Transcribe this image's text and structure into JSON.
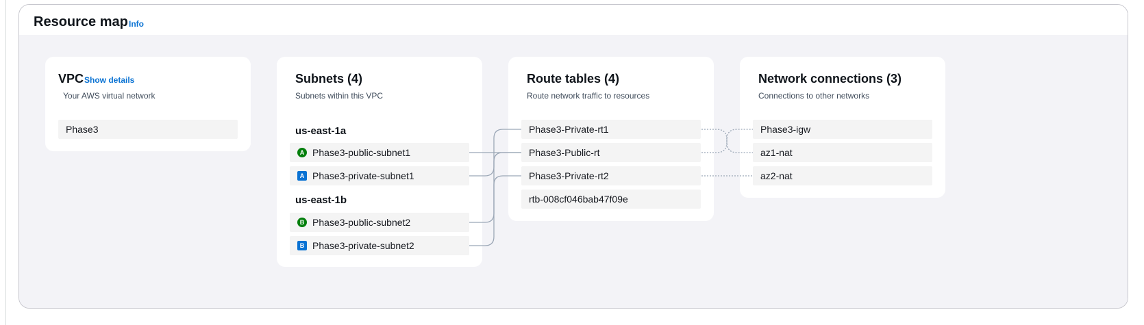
{
  "header": {
    "title": "Resource map",
    "info_label": "Info"
  },
  "vpc": {
    "title": "VPC",
    "show_details_label": "Show details",
    "description": "Your AWS virtual network",
    "name": "Phase3"
  },
  "subnets": {
    "title": "Subnets (4)",
    "description": "Subnets within this VPC",
    "zones": [
      {
        "name": "us-east-1a",
        "items": [
          {
            "badge": "A",
            "type": "public",
            "label": "Phase3-public-subnet1"
          },
          {
            "badge": "A",
            "type": "private",
            "label": "Phase3-private-subnet1"
          }
        ]
      },
      {
        "name": "us-east-1b",
        "items": [
          {
            "badge": "B",
            "type": "public",
            "label": "Phase3-public-subnet2"
          },
          {
            "badge": "B",
            "type": "private",
            "label": "Phase3-private-subnet2"
          }
        ]
      }
    ]
  },
  "route_tables": {
    "title": "Route tables (4)",
    "description": "Route network traffic to resources",
    "items": [
      "Phase3-Private-rt1",
      "Phase3-Public-rt",
      "Phase3-Private-rt2",
      "rtb-008cf046bab47f09e"
    ]
  },
  "network_connections": {
    "title": "Network connections (3)",
    "description": "Connections to other networks",
    "items": [
      "Phase3-igw",
      "az1-nat",
      "az2-nat"
    ]
  },
  "colors": {
    "link": "#0972d3",
    "public_badge": "#037f0c",
    "private_badge": "#0972d3",
    "connector": "#9ba7b6",
    "map_background": "#f3f3f7"
  }
}
